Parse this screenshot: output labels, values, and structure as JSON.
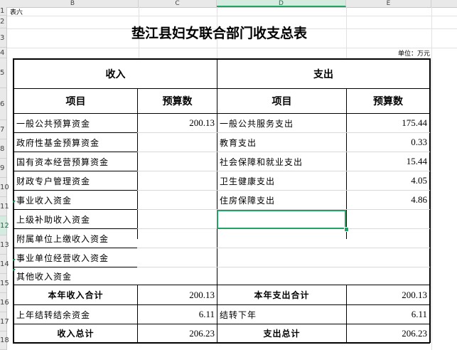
{
  "columns": [
    "B",
    "C",
    "D",
    "E"
  ],
  "row_numbers": [
    "1",
    "2",
    "3",
    "4",
    "5",
    "6",
    "7",
    "8",
    "9",
    "10",
    "11",
    "12",
    "13",
    "14",
    "15",
    "16",
    "17",
    "18"
  ],
  "selected_cell": "D12",
  "note_label": "表六",
  "title": "垫江县妇女联合部门收支总表",
  "unit": "单位：万元",
  "income_header": "收入",
  "expense_header": "支出",
  "item_header": "项目",
  "budget_header": "预算数",
  "income_items": [
    {
      "name": "一般公共预算资金",
      "value": "200.13"
    },
    {
      "name": "政府性基金预算资金",
      "value": ""
    },
    {
      "name": "国有资本经营预算资金",
      "value": ""
    },
    {
      "name": "财政专户管理资金",
      "value": ""
    },
    {
      "name": "事业收入资金",
      "value": ""
    },
    {
      "name": "上级补助收入资金",
      "value": ""
    },
    {
      "name": "附属单位上缴收入资金",
      "value": ""
    },
    {
      "name": "事业单位经营收入资金",
      "value": ""
    },
    {
      "name": "其他收入资金",
      "value": ""
    }
  ],
  "expense_items": [
    {
      "name": "一般公共服务支出",
      "value": "175.44"
    },
    {
      "name": "教育支出",
      "value": "0.33"
    },
    {
      "name": "社会保障和就业支出",
      "value": "15.44"
    },
    {
      "name": "卫生健康支出",
      "value": "4.05"
    },
    {
      "name": "住房保障支出",
      "value": "4.86"
    },
    {
      "name": "",
      "value": ""
    },
    {
      "name": "",
      "value": ""
    },
    {
      "name": "",
      "value": ""
    },
    {
      "name": "",
      "value": ""
    }
  ],
  "income_total_label": "本年收入合计",
  "income_total": "200.13",
  "expense_total_label": "本年支出合计",
  "expense_total": "200.13",
  "carryover_label": "上年结转结余资金",
  "carryover": "6.11",
  "carryforward_label": "结转下年",
  "carryforward": "6.11",
  "income_grand_label": "收入总计",
  "income_grand": "206.23",
  "expense_grand_label": "支出总计",
  "expense_grand": "206.23",
  "colors": {
    "selection": "#21a366",
    "header_bg": "#e9e9e9"
  }
}
